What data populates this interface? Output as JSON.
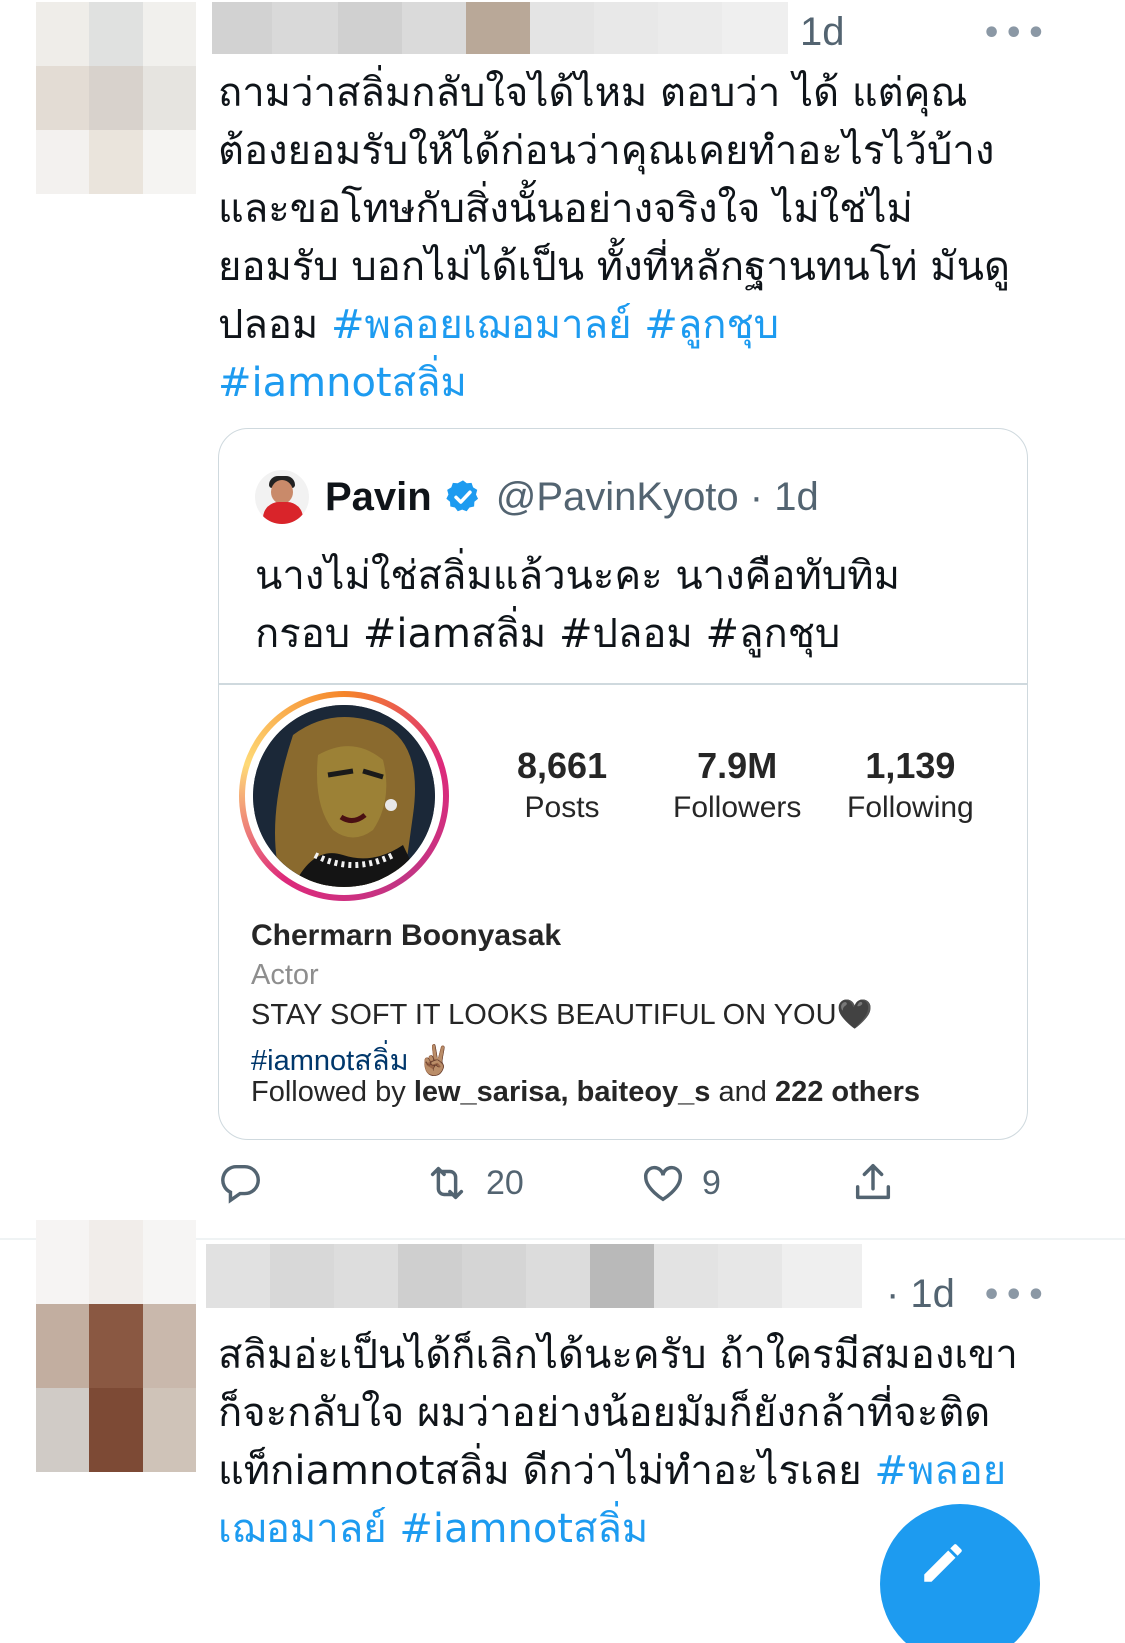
{
  "tweet1": {
    "time": "1d",
    "more": "•••",
    "lines": [
      {
        "text": "ถามว่าสลิ่มกลับใจได้ไหม ตอบว่า ได้ แต่คุณ",
        "tag": ""
      },
      {
        "text": "ต้องยอมรับให้ได้ก่อนว่าคุณเคยทำอะไรไว้บ้าง",
        "tag": ""
      },
      {
        "text": "และขอโทษกับสิ่งนั้นอย่างจริงใจ ไม่ใช่ไม่",
        "tag": ""
      },
      {
        "text": "ยอมรับ บอกไม่ได้เป็น ทั้งที่หลักฐานทนโท่ มันดู",
        "tag": ""
      },
      {
        "text": "ปลอม ",
        "tag": "#พลอยเฌอมาลย์ #ลูกชุบ"
      },
      {
        "text": "",
        "tag": "#iamnotสลิ่ม"
      }
    ],
    "quote": {
      "name": "Pavin",
      "handle": "@PavinKyoto · 1d",
      "lines": [
        "นางไม่ใช่สลิ่มแล้วนะคะ นางคือทับทิม",
        "กรอบ #iamสลิ่ม #ปลอม #ลูกชุบ"
      ],
      "ig": {
        "stats": [
          {
            "num": "8,661",
            "label": "Posts"
          },
          {
            "num": "7.9M",
            "label": "Followers"
          },
          {
            "num": "1,139",
            "label": "Following"
          }
        ],
        "name": "Chermarn Boonyasak",
        "category": "Actor",
        "bio": "STAY SOFT IT LOOKS BEAUTIFUL ON YOU🖤",
        "bio_tag": "#iamnotสลิ่ม ✌🏽",
        "followed_prefix": "Followed by ",
        "followed_users": "lew_sarisa, baiteoy_s",
        "followed_and": " and ",
        "followed_others": "222 others"
      }
    },
    "actions": {
      "retweets": "20",
      "likes": "9"
    }
  },
  "tweet2": {
    "time": "· 1d",
    "more": "•••",
    "lines": [
      {
        "text": "สลิมอ่ะเป็นได้ก็เลิกได้นะครับ ถ้าใครมีสมองเขา",
        "tag": ""
      },
      {
        "text": "ก็จะกลับใจ ผมว่าอย่างน้อยมัมก็ยังกล้าที่จะติด",
        "tag": ""
      },
      {
        "text": "แท็กiamnotสลิ่ม ดีกว่าไม่ทำอะไรเลย ",
        "tag": "#พลอย"
      },
      {
        "text": "",
        "tag": "เฌอมาลย์ #iamnotสลิ่ม"
      }
    ]
  },
  "colors": {
    "link": "#1d9bf0",
    "muted": "#536471",
    "border": "#cfd9de",
    "ig_link": "#00376b"
  },
  "icons": [
    "reply-icon",
    "retweet-icon",
    "like-icon",
    "share-icon",
    "verified-icon",
    "more-icon",
    "compose-icon"
  ]
}
